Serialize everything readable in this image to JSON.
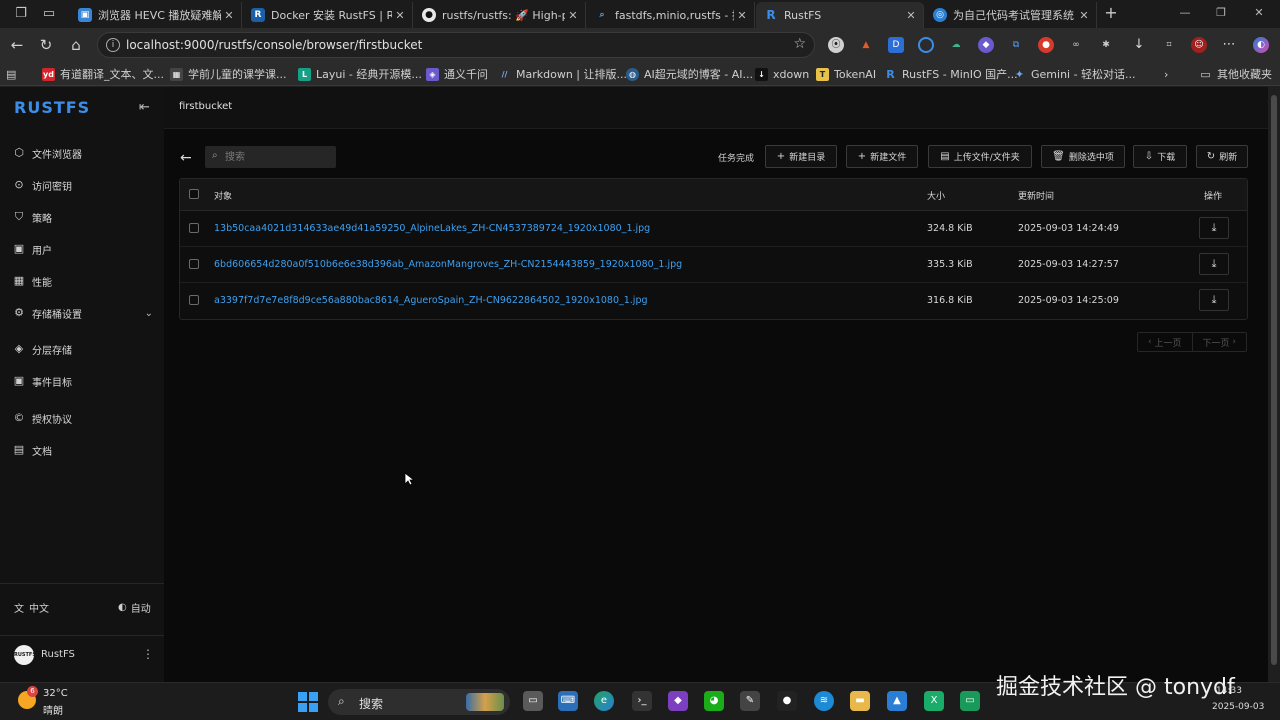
{
  "browser": {
    "tabs": [
      {
        "label": "浏览器 HEVC 播放疑难解答",
        "icon": "hevc-tab-icon"
      },
      {
        "label": "Docker 安装 RustFS | RustFS",
        "icon": "rustfs-tab-icon"
      },
      {
        "label": "rustfs/rustfs: 🚀 High-perf",
        "icon": "github-tab-icon"
      },
      {
        "label": "fastdfs,minio,rustfs - 搜索",
        "icon": "search-tab-icon"
      },
      {
        "label": "RustFS",
        "icon": "rustfs-tab-icon",
        "active": true
      },
      {
        "label": "为自己代码考试管理系统",
        "icon": "exam-tab-icon"
      }
    ],
    "url": "localhost:9000/rustfs/console/browser/firstbucket",
    "bookmarks": [
      {
        "label": "有道翻译_文本、文...",
        "icon": "youdao-icon"
      },
      {
        "label": "学前儿童的课学课...",
        "icon": "grid-icon"
      },
      {
        "label": "Layui - 经典开源模...",
        "icon": "layui-icon"
      },
      {
        "label": "通义千问",
        "icon": "tongyi-icon"
      },
      {
        "label": "Markdown | 让排版...",
        "icon": "markdown-icon"
      },
      {
        "label": "AI超元域的博客 - AI...",
        "icon": "globe-icon"
      },
      {
        "label": "xdown",
        "icon": "download-icon"
      },
      {
        "label": "TokenAI",
        "icon": "tokenai-icon"
      },
      {
        "label": "RustFS - MinIO 国产...",
        "icon": "rustfs-icon"
      },
      {
        "label": "Gemini - 轻松对话...",
        "icon": "gemini-icon"
      }
    ],
    "other_bookmarks": "其他收藏夹"
  },
  "app": {
    "logo": "RUSTFS",
    "breadcrumb": "firstbucket",
    "nav": [
      {
        "label": "文件浏览器",
        "icon": "cube-icon"
      },
      {
        "label": "访问密钥",
        "icon": "key-icon"
      },
      {
        "label": "策略",
        "icon": "shield-icon"
      },
      {
        "label": "用户",
        "icon": "user-icon"
      },
      {
        "label": "性能",
        "icon": "chart-icon"
      },
      {
        "label": "存储桶设置",
        "icon": "gear-icon"
      },
      {
        "label": "分层存储",
        "icon": "layers-icon"
      },
      {
        "label": "事件目标",
        "icon": "target-icon"
      },
      {
        "label": "授权协议",
        "icon": "copyright-icon"
      },
      {
        "label": "文档",
        "icon": "doc-icon"
      }
    ],
    "language": "中文",
    "theme": "自动",
    "avatar_text": "RUSTFS",
    "user_name": "RustFS"
  },
  "toolbar": {
    "search_placeholder": "搜索",
    "task_status": "任务完成",
    "new_folder": "新建目录",
    "new_file": "新建文件",
    "upload": "上传文件/文件夹",
    "delete_selected": "删除选中项",
    "download": "下载",
    "refresh": "刷新"
  },
  "table": {
    "columns": [
      "对象",
      "大小",
      "更新时间",
      "操作"
    ],
    "rows": [
      {
        "name": "13b50caa4021d314633ae49d41a59250_AlpineLakes_ZH-CN4537389724_1920x1080_1.jpg",
        "size": "324.8 KiB",
        "updated": "2025-09-03 14:24:49"
      },
      {
        "name": "6bd606654d280a0f510b6e6e38d396ab_AmazonMangroves_ZH-CN2154443859_1920x1080_1.jpg",
        "size": "335.3 KiB",
        "updated": "2025-09-03 14:27:57"
      },
      {
        "name": "a3397f7d7e7e8f8d9ce56a880bac8614_AgueroSpain_ZH-CN9622864502_1920x1080_1.jpg",
        "size": "316.8 KiB",
        "updated": "2025-09-03 14:25:09"
      }
    ]
  },
  "pagination": {
    "prev": "上一页",
    "next": "下一页"
  },
  "taskbar": {
    "temperature": "32°C",
    "weather": "晴朗",
    "weather_badge": "6",
    "search_label": "搜索",
    "time": "14:33",
    "date": "2025-09-03"
  },
  "watermark": "掘金技术社区 @ tonydf"
}
